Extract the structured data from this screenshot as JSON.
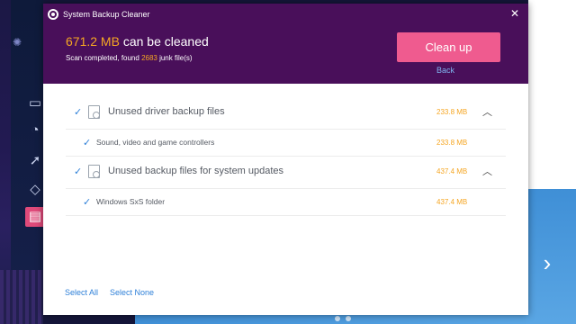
{
  "dialog": {
    "title": "System Backup Cleaner",
    "close_icon": "close-icon",
    "summary": {
      "size": "671.2 MB",
      "suffix": " can be cleaned"
    },
    "scan": {
      "prefix": "Scan completed, found ",
      "count": "2683",
      "suffix": " junk file(s)"
    },
    "cleanup_label": "Clean up",
    "back_label": "Back"
  },
  "groups": [
    {
      "label": "Unused driver backup files",
      "size": "233.8 MB",
      "children": [
        {
          "label": "Sound, video and game controllers",
          "size": "233.8 MB"
        }
      ]
    },
    {
      "label": "Unused backup files for system updates",
      "size": "437.4 MB",
      "children": [
        {
          "label": "Windows SxS folder",
          "size": "437.4 MB"
        }
      ]
    }
  ],
  "footer": {
    "select_all": "Select All",
    "select_none": "Select None"
  },
  "colors": {
    "header_bg": "#490f5a",
    "accent_orange": "#f5a623",
    "cleanup_button": "#ef5b8f",
    "link_blue": "#2f80d8"
  }
}
